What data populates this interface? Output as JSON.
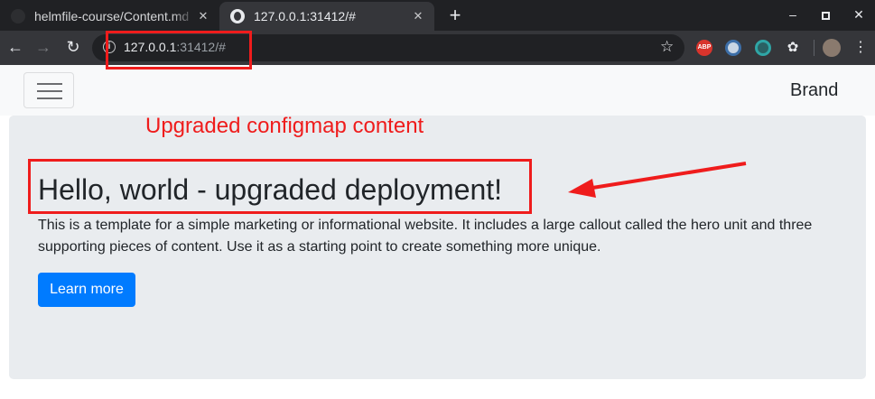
{
  "browser": {
    "tabs": [
      {
        "title": "helmfile-course/Content.md"
      },
      {
        "title": "127.0.0.1:31412/#"
      }
    ],
    "url_host": "127.0.0.1",
    "url_rest": ":31412/#",
    "extensions": [
      "abp-icon",
      "extension-icon",
      "extension-icon",
      "extension-icon"
    ],
    "extension_abp_label": "ABP"
  },
  "page": {
    "brand": "Brand",
    "hero": {
      "title": "Hello, world - upgraded deployment!",
      "lead": "This is a template for a simple marketing or informational website. It includes a large callout called the hero unit and three supporting pieces of content. Use it as a starting point to create something more unique.",
      "button_label": "Learn more"
    }
  },
  "annotation": {
    "text": "Upgraded configmap content",
    "color": "#ef1c1c"
  },
  "colors": {
    "primary": "#007bff",
    "jumbotron": "#e9ecef",
    "chrome_dark": "#202124"
  }
}
